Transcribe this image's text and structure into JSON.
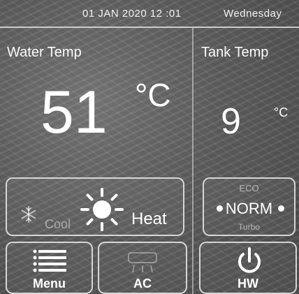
{
  "status_bar": {
    "datetime": "01 JAN 2020 12 :01",
    "weekday": "Wednesday"
  },
  "water": {
    "title": "Water Temp",
    "value": "51",
    "unit": "°C"
  },
  "tank": {
    "title": "Tank Temp",
    "value": "9",
    "unit": "°C"
  },
  "mode": {
    "cool_label": "Cool",
    "heat_label": "Heat",
    "selected": "Heat",
    "cool_icon": "snowflake-icon",
    "heat_icon": "sun-icon"
  },
  "fan": {
    "options": [
      "ECO",
      "NORM",
      "Turbo"
    ],
    "eco_label": "ECO",
    "norm_label": "NORM",
    "turbo_label": "Turbo",
    "selected": "NORM"
  },
  "buttons": {
    "menu_label": "Menu",
    "menu_icon": "menu-icon",
    "ac_label": "AC",
    "ac_icon": "ac-icon",
    "hw_label": "HW",
    "hw_icon": "power-icon"
  }
}
